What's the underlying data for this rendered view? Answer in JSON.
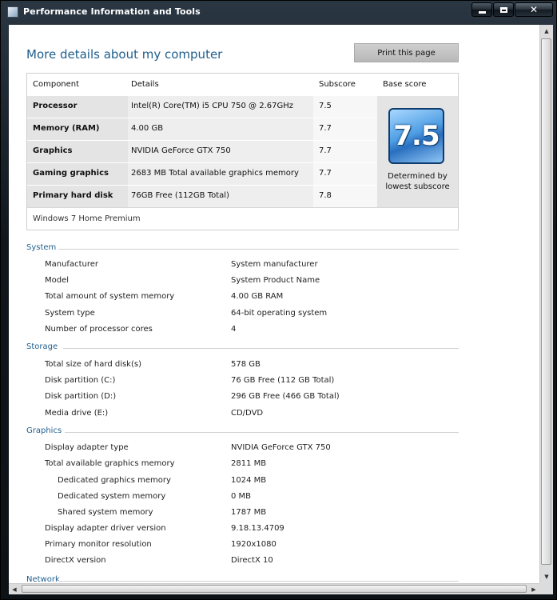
{
  "window": {
    "title": "Performance Information and Tools"
  },
  "page": {
    "heading": "More details about my computer",
    "print_button": "Print this page"
  },
  "score_table": {
    "headers": {
      "component": "Component",
      "details": "Details",
      "subscore": "Subscore",
      "base": "Base score"
    },
    "rows": [
      {
        "component": "Processor",
        "details": "Intel(R) Core(TM) i5 CPU 750 @ 2.67GHz",
        "subscore": "7.5"
      },
      {
        "component": "Memory (RAM)",
        "details": "4.00 GB",
        "subscore": "7.7"
      },
      {
        "component": "Graphics",
        "details": "NVIDIA GeForce GTX 750",
        "subscore": "7.7"
      },
      {
        "component": "Gaming graphics",
        "details": "2683 MB Total available graphics memory",
        "subscore": "7.7"
      },
      {
        "component": "Primary hard disk",
        "details": "76GB Free (112GB Total)",
        "subscore": "7.8"
      }
    ],
    "base_score": "7.5",
    "base_caption_1": "Determined by",
    "base_caption_2": "lowest subscore",
    "edition": "Windows 7 Home Premium"
  },
  "system": {
    "title": "System",
    "rows": [
      {
        "k": "Manufacturer",
        "v": "System manufacturer"
      },
      {
        "k": "Model",
        "v": "System Product Name"
      },
      {
        "k": "Total amount of system memory",
        "v": "4.00 GB RAM"
      },
      {
        "k": "System type",
        "v": "64-bit operating system"
      },
      {
        "k": "Number of processor cores",
        "v": "4"
      }
    ]
  },
  "storage": {
    "title": "Storage",
    "rows": [
      {
        "k": "Total size of hard disk(s)",
        "v": "578 GB"
      },
      {
        "k": "Disk partition (C:)",
        "v": "76 GB Free (112 GB Total)"
      },
      {
        "k": "Disk partition (D:)",
        "v": "296 GB Free (466 GB Total)"
      },
      {
        "k": "Media drive (E:)",
        "v": "CD/DVD"
      }
    ]
  },
  "graphics": {
    "title": "Graphics",
    "rows": [
      {
        "k": "Display adapter type",
        "v": "NVIDIA GeForce GTX 750"
      },
      {
        "k": "Total available graphics memory",
        "v": "2811 MB"
      },
      {
        "k": "Dedicated graphics memory",
        "v": "1024 MB"
      },
      {
        "k": "Dedicated system memory",
        "v": "0 MB"
      },
      {
        "k": "Shared system memory",
        "v": "1787 MB"
      },
      {
        "k": "Display adapter driver version",
        "v": "9.18.13.4709"
      },
      {
        "k": "Primary monitor resolution",
        "v": "1920x1080"
      },
      {
        "k": "DirectX version",
        "v": "DirectX 10"
      }
    ]
  },
  "network": {
    "title": "Network"
  },
  "icons": {
    "window": "window-app-icon",
    "minimize": "minimize-icon",
    "maximize": "maximize-icon",
    "close": "close-icon"
  }
}
